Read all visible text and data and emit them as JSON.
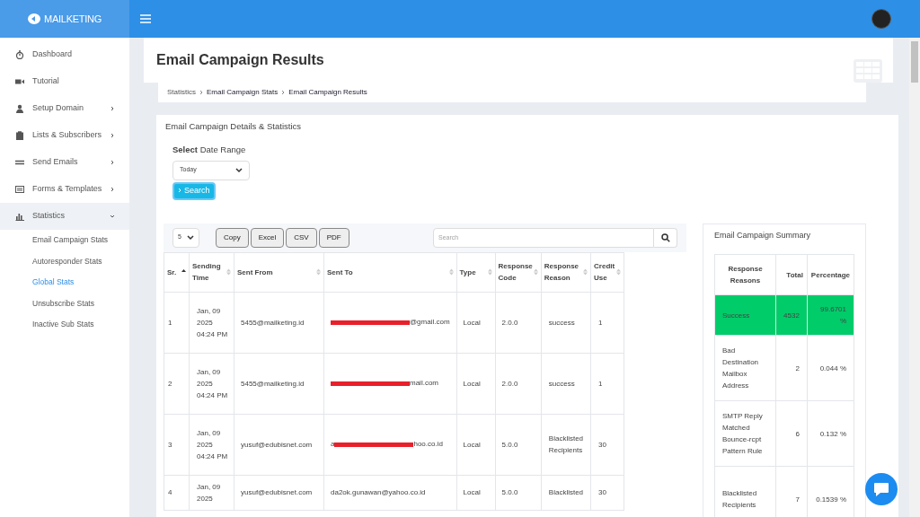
{
  "brand": {
    "name": "MAILKETING"
  },
  "sidebar": {
    "items": [
      {
        "label": "Dashboard",
        "has_arrow": false,
        "expanded": false
      },
      {
        "label": "Tutorial",
        "has_arrow": false,
        "expanded": false
      },
      {
        "label": "Setup Domain",
        "has_arrow": true,
        "expanded": false
      },
      {
        "label": "Lists & Subscribers",
        "has_arrow": true,
        "expanded": false
      },
      {
        "label": "Send Emails",
        "has_arrow": true,
        "expanded": false
      },
      {
        "label": "Forms & Templates",
        "has_arrow": true,
        "expanded": false
      },
      {
        "label": "Statistics",
        "has_arrow": true,
        "expanded": true,
        "children": [
          {
            "label": "Email Campaign Stats",
            "selected": false
          },
          {
            "label": "Autoresponder Stats",
            "selected": false
          },
          {
            "label": "Global Stats",
            "selected": true
          },
          {
            "label": "Unsubscribe Stats",
            "selected": false
          },
          {
            "label": "Inactive Sub Stats",
            "selected": false
          }
        ]
      }
    ]
  },
  "page": {
    "title": "Email Campaign Results",
    "breadcrumb": [
      "Statistics",
      "Email Campaign Stats",
      "Email Campaign Results"
    ]
  },
  "card": {
    "title": "Email Campaign Details & Statistics",
    "date_label": "**Select** Date Range",
    "date_value": "Today",
    "search_button": "Search"
  },
  "table": {
    "page_size": "5",
    "buttons": [
      "Copy",
      "Excel",
      "CSV",
      "PDF"
    ],
    "search_placeholder": "Search",
    "columns": [
      {
        "label": "Sr.",
        "sorted": true
      },
      {
        "label": "Sending Time",
        "sorted": false
      },
      {
        "label": "Sent From",
        "sorted": false
      },
      {
        "label": "Sent To",
        "sorted": false
      },
      {
        "label": "Type",
        "sorted": false
      },
      {
        "label": "Response Code",
        "sorted": false
      },
      {
        "label": "Response Reason",
        "sorted": false
      },
      {
        "label": "Credit Use",
        "sorted": false
      }
    ],
    "rows": [
      {
        "sr": "1",
        "time": "Jan, 09 2025 04:24 PM",
        "from": "5455@mailketing.id",
        "to_before": "",
        "redacted": true,
        "to_after": "@gmail.com",
        "type": "Local",
        "code": "2.0.0",
        "reason": "success",
        "credit": "1"
      },
      {
        "sr": "2",
        "time": "Jan, 09 2025 04:24 PM",
        "from": "5455@mailketing.id",
        "to_before": "",
        "redacted": true,
        "to_after": "mail.com",
        "type": "Local",
        "code": "2.0.0",
        "reason": "success",
        "credit": "1"
      },
      {
        "sr": "3",
        "time": "Jan, 09 2025 04:24 PM",
        "from": "yusuf@edubisnet.com",
        "to_before": "a",
        "redacted": true,
        "to_after": "hoo.co.id",
        "type": "Local",
        "code": "5.0.0",
        "reason": "Blacklisted Recipients",
        "credit": "30"
      },
      {
        "sr": "4",
        "time": "Jan, 09 2025",
        "from": "yusuf@edubisnet.com",
        "to_before": "",
        "redacted": false,
        "to_after": "da2ok.gunawan@yahoo.co.id",
        "type": "Local",
        "code": "5.0.0",
        "reason": "Blacklisted",
        "credit": "30"
      }
    ]
  },
  "summary": {
    "title": "Email Campaign Summary",
    "columns": [
      "Response Reasons",
      "Total",
      "Percentage"
    ],
    "rows": [
      {
        "reason": "Success",
        "total": "4532",
        "percentage": "99.6701 %",
        "highlighted": true
      },
      {
        "reason": "Bad Destination Mailbox Address",
        "total": "2",
        "percentage": "0.044 %",
        "highlighted": false
      },
      {
        "reason": "SMTP Reply Matched Bounce-rcpt Pattern Rule",
        "total": "6",
        "percentage": "0.132 %",
        "highlighted": false
      },
      {
        "reason": "Blacklisted Recipients",
        "total": "7",
        "percentage": "0.1539 %",
        "highlighted": false
      }
    ]
  }
}
